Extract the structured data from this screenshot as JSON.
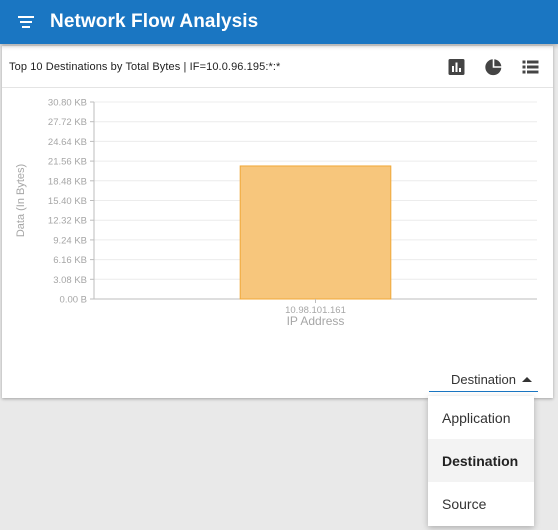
{
  "app": {
    "title": "Network Flow Analysis"
  },
  "card": {
    "title": "Top 10 Destinations by Total Bytes | IF=10.0.96.195:*:*",
    "icons": [
      "bar-chart-icon",
      "pie-chart-icon",
      "list-icon"
    ]
  },
  "chart_data": {
    "type": "bar",
    "categories": [
      "10.98.101.161"
    ],
    "values": [
      20.8
    ],
    "value_unit": "KB",
    "xlabel": "IP Address",
    "ylabel": "Data (In Bytes)",
    "yticks": [
      "0.00 B",
      "3.08 KB",
      "6.16 KB",
      "9.24 KB",
      "12.32 KB",
      "15.40 KB",
      "18.48 KB",
      "21.56 KB",
      "24.64 KB",
      "27.72 KB",
      "30.80 KB"
    ],
    "ylim": [
      0,
      30.8
    ],
    "grid": true,
    "bar_color": "#f7c67c",
    "bar_stroke": "#f0a838"
  },
  "dropdown": {
    "value": "Destination",
    "options": [
      "Application",
      "Destination",
      "Source"
    ],
    "selected": 1
  },
  "colors": {
    "appbar": "#1a76c2",
    "accent": "#1a76c2"
  }
}
